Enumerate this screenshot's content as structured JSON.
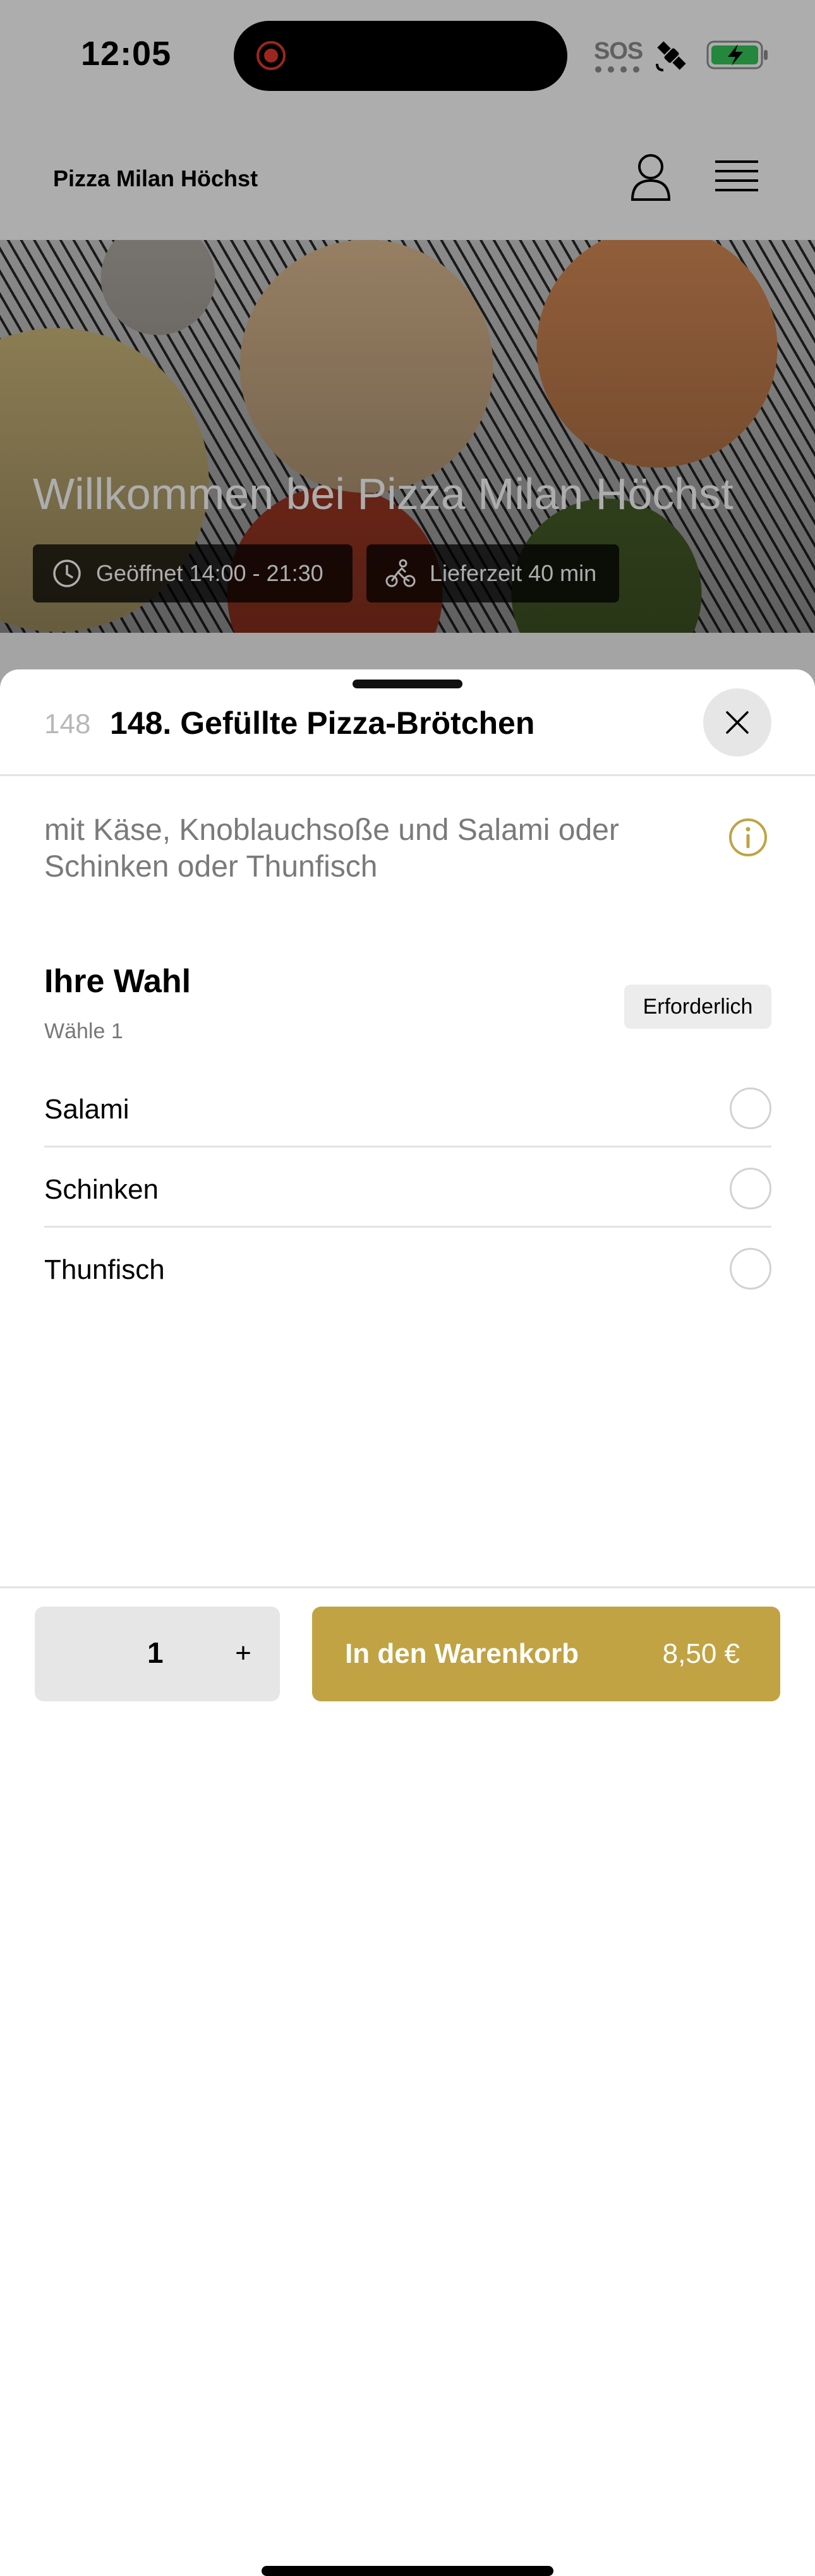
{
  "status_bar": {
    "time": "12:05",
    "sos": "SOS",
    "icons": [
      "recording-indicator-icon",
      "satellite-icon",
      "battery-charging-icon"
    ]
  },
  "header": {
    "title": "Pizza Milan Höchst",
    "icons": [
      "user-icon",
      "hamburger-menu-icon"
    ]
  },
  "hero": {
    "title": "Willkommen bei Pizza Milan Höchst",
    "opening_hours": "Geöffnet 14:00 - 21:30",
    "delivery_time": "Lieferzeit 40 min"
  },
  "item": {
    "number": "148",
    "title": "148. Gefüllte Pizza-Brötchen",
    "description": "mit Käse, Knoblauchsoße und Salami oder Schinken oder Thunfisch"
  },
  "choice_group": {
    "title": "Ihre Wahl",
    "subtitle": "Wähle 1",
    "badge": "Erforderlich",
    "options": [
      {
        "label": "Salami",
        "selected": false
      },
      {
        "label": "Schinken",
        "selected": false
      },
      {
        "label": "Thunfisch",
        "selected": false
      }
    ]
  },
  "footer": {
    "quantity": "1",
    "plus": "+",
    "add_to_cart": "In den Warenkorb",
    "price": "8,50 €"
  },
  "colors": {
    "accent": "#c1a344",
    "text_muted": "#7a7a7a"
  }
}
